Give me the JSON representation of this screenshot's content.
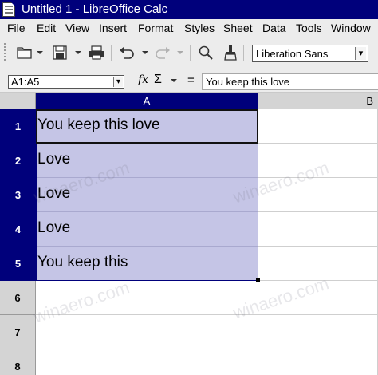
{
  "window": {
    "title": "Untitled 1 - LibreOffice Calc"
  },
  "menu": [
    "File",
    "Edit",
    "View",
    "Insert",
    "Format",
    "Styles",
    "Sheet",
    "Data",
    "Tools",
    "Window"
  ],
  "toolbar": {
    "font_name": "Liberation Sans",
    "icons": [
      "open-icon",
      "save-icon",
      "print-icon",
      "undo-icon",
      "redo-icon",
      "find-icon",
      "clone-formatting-icon"
    ]
  },
  "formula_bar": {
    "name_box": "A1:A5",
    "function_wizard": "fx",
    "sum_symbol": "Σ",
    "equals": "=",
    "content": "You keep this love"
  },
  "sheet": {
    "columns": [
      "A",
      "B"
    ],
    "rows": [
      "1",
      "2",
      "3",
      "4",
      "5",
      "6",
      "7",
      "8"
    ],
    "cells_a": [
      "You keep this love",
      "Love",
      "Love",
      "Love",
      "You keep this",
      "",
      "",
      ""
    ],
    "selected_range": "A1:A5",
    "active_cell": "A1"
  },
  "watermark": "winaero.com",
  "colors": {
    "title_bar": "#00007b",
    "selection_fill": "#c5c5e6",
    "header_selected": "#00007b",
    "chrome": "#ececec"
  }
}
